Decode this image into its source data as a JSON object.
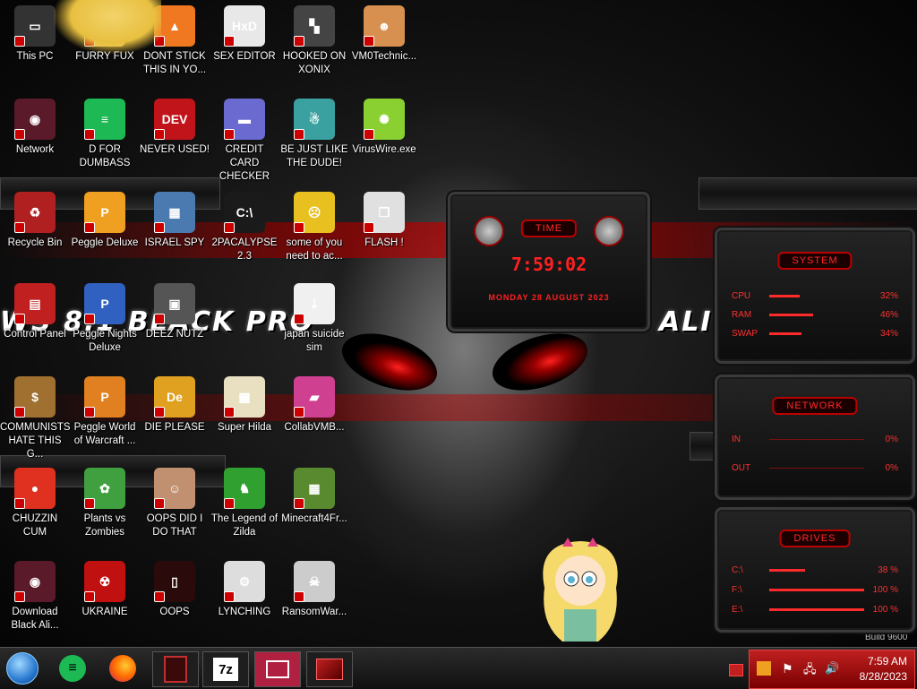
{
  "desktop_icons": [
    {
      "label": "This PC",
      "color": "#333333",
      "glyph": "▭"
    },
    {
      "label": "FURRY FUX",
      "color": "#f0d060",
      "glyph": "☺"
    },
    {
      "label": "DONT STICK THIS IN YO...",
      "color": "#f07820",
      "glyph": "▲"
    },
    {
      "label": "SEX EDITOR",
      "color": "#e8e8e8",
      "glyph": "HxD"
    },
    {
      "label": "HOOKED ON XONIX",
      "color": "#444444",
      "glyph": "▚"
    },
    {
      "label": "VM0Technic...",
      "color": "#d89050",
      "glyph": "☻"
    },
    {
      "label": "Network",
      "color": "#5a1a2a",
      "glyph": "◉"
    },
    {
      "label": "D FOR DUMBASS",
      "color": "#1db954",
      "glyph": "≡"
    },
    {
      "label": "NEVER USED!",
      "color": "#c0141a",
      "glyph": "DEV"
    },
    {
      "label": "CREDIT CARD CHECKER",
      "color": "#6a6ad0",
      "glyph": "▬"
    },
    {
      "label": "BE JUST LIKE THE DUDE!",
      "color": "#3aa0a0",
      "glyph": "☃"
    },
    {
      "label": "VirusWire.exe",
      "color": "#8ad030",
      "glyph": "✺"
    },
    {
      "label": "Recycle Bin",
      "color": "#b02020",
      "glyph": "♻"
    },
    {
      "label": "Peggle Deluxe",
      "color": "#f0a020",
      "glyph": "P"
    },
    {
      "label": "ISRAEL SPY",
      "color": "#4a7ab0",
      "glyph": "▦"
    },
    {
      "label": "2PACALYPSE 2.3",
      "color": "#1a1a1a",
      "glyph": "C:\\"
    },
    {
      "label": "some of you need to ac...",
      "color": "#e8c020",
      "glyph": "☹"
    },
    {
      "label": "FLASH !",
      "color": "#e0e0e0",
      "glyph": "❐"
    },
    {
      "label": "Control Panel",
      "color": "#c02020",
      "glyph": "▤"
    },
    {
      "label": "Peggle Nights Deluxe",
      "color": "#3060c0",
      "glyph": "P"
    },
    {
      "label": "DEEZ NUTZ",
      "color": "#555555",
      "glyph": "▣"
    },
    {
      "label": "japan suicide sim",
      "color": "#f0f0f0",
      "glyph": "⇣"
    },
    {
      "label": "COMMUNISTS HATE THIS G...",
      "color": "#a07030",
      "glyph": "$"
    },
    {
      "label": "Peggle World of Warcraft ...",
      "color": "#e08020",
      "glyph": "P"
    },
    {
      "label": "DIE PLEASE",
      "color": "#e0a020",
      "glyph": "De"
    },
    {
      "label": "Super Hilda",
      "color": "#e8e0c0",
      "glyph": "▩"
    },
    {
      "label": "CollabVMB...",
      "color": "#d04090",
      "glyph": "▰"
    },
    {
      "label": "CHUZZIN CUM",
      "color": "#e03020",
      "glyph": "●"
    },
    {
      "label": "Plants vs Zombies",
      "color": "#40a040",
      "glyph": "✿"
    },
    {
      "label": "OOPS DID I DO THAT",
      "color": "#c09070",
      "glyph": "☺"
    },
    {
      "label": "The Legend of Zilda",
      "color": "#30a030",
      "glyph": "♞"
    },
    {
      "label": "Minecraft4Fr...",
      "color": "#5a8a30",
      "glyph": "▦"
    },
    {
      "label": "Download Black Ali...",
      "color": "#5a1a2a",
      "glyph": "◉"
    },
    {
      "label": "UKRAINE",
      "color": "#c01010",
      "glyph": "☢"
    },
    {
      "label": "OOPS",
      "color": "#2a0a0a",
      "glyph": "▯"
    },
    {
      "label": "LYNCHING",
      "color": "#dddddd",
      "glyph": "⚙"
    },
    {
      "label": "RansomWar...",
      "color": "#cccccc",
      "glyph": "☠"
    }
  ],
  "wallpaper": {
    "left_text": "WS 8.1 BLACK PRO",
    "right_text": "ALI",
    "build": "Build 9600"
  },
  "time_widget": {
    "title": "TIME",
    "time": "7:59:02",
    "date": "MONDAY 28 AUGUST 2023"
  },
  "system_widget": {
    "title": "SYSTEM",
    "rows": [
      {
        "label": "CPU",
        "pct": "32%",
        "fill": 0.32
      },
      {
        "label": "RAM",
        "pct": "46%",
        "fill": 0.46
      },
      {
        "label": "SWAP",
        "pct": "34%",
        "fill": 0.34
      }
    ]
  },
  "network_widget": {
    "title": "NETWORK",
    "rows": [
      {
        "label": "IN",
        "pct": "0%"
      },
      {
        "label": "OUT",
        "pct": "0%"
      }
    ]
  },
  "drives_widget": {
    "title": "DRIVES",
    "rows": [
      {
        "label": "C:\\",
        "pct": "38 %",
        "fill": 0.38
      },
      {
        "label": "F:\\",
        "pct": "100 %",
        "fill": 1.0
      },
      {
        "label": "E:\\",
        "pct": "100 %",
        "fill": 1.0
      }
    ]
  },
  "taskbar": {
    "clock_time": "7:59 AM",
    "clock_date": "8/28/2023",
    "seven_zip": "7z"
  }
}
